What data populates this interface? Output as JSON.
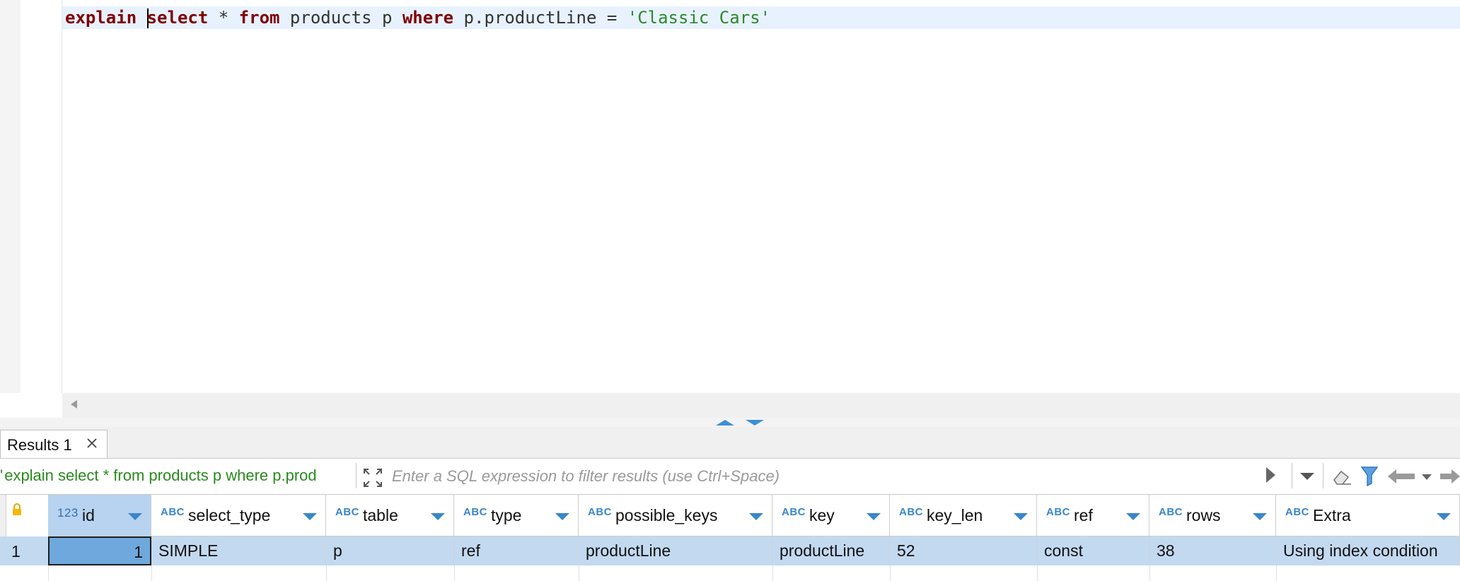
{
  "editor": {
    "tokens": [
      {
        "text": "explain",
        "kind": "kw"
      },
      {
        "text": " ",
        "kind": "plain"
      },
      {
        "text": "select",
        "kind": "kw",
        "caret_before": true
      },
      {
        "text": " * ",
        "kind": "plain"
      },
      {
        "text": "from",
        "kind": "kw"
      },
      {
        "text": " products p ",
        "kind": "plain"
      },
      {
        "text": "where",
        "kind": "kw"
      },
      {
        "text": " p.productLine = ",
        "kind": "plain"
      },
      {
        "text": "'Classic Cars'",
        "kind": "str"
      }
    ]
  },
  "results": {
    "tab_label": "Results 1",
    "query_text": "explain select * from products p where p.prod",
    "filter_placeholder": "Enter a SQL expression to filter results (use Ctrl+Space)",
    "columns": [
      {
        "type": "123",
        "name": "id"
      },
      {
        "type": "ABC",
        "name": "select_type"
      },
      {
        "type": "ABC",
        "name": "table"
      },
      {
        "type": "ABC",
        "name": "type"
      },
      {
        "type": "ABC",
        "name": "possible_keys"
      },
      {
        "type": "ABC",
        "name": "key"
      },
      {
        "type": "ABC",
        "name": "key_len"
      },
      {
        "type": "ABC",
        "name": "ref"
      },
      {
        "type": "ABC",
        "name": "rows"
      },
      {
        "type": "ABC",
        "name": "Extra"
      }
    ],
    "rows": [
      {
        "row_number": "1",
        "cells": [
          "1",
          "SIMPLE",
          "p",
          "ref",
          "productLine",
          "productLine",
          "52",
          "const",
          "38",
          "Using index condition"
        ]
      }
    ]
  },
  "colors": {
    "keyword": "#7f0000",
    "string": "#2a8a2a",
    "selection": "#c3d9f0",
    "accent": "#3a86c9"
  },
  "icons": [
    "close-icon",
    "expand-icon",
    "play-icon",
    "chevron-down-icon",
    "eraser-icon",
    "filter-icon",
    "back-arrow-icon",
    "forward-arrow-icon",
    "lock-icon",
    "sort-icon"
  ]
}
